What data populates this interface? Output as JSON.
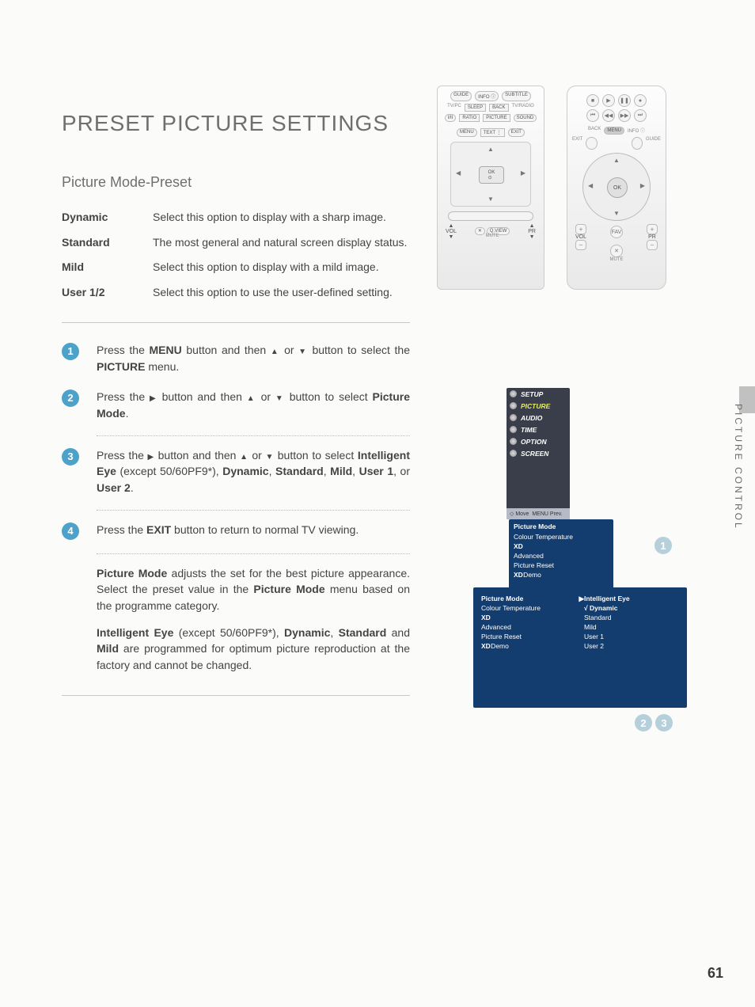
{
  "title": "PRESET PICTURE SETTINGS",
  "subtitle": "Picture Mode-Preset",
  "presets": [
    {
      "term": "Dynamic",
      "desc": "Select this option to display with a sharp image."
    },
    {
      "term": "Standard",
      "desc": "The most general and natural screen display status."
    },
    {
      "term": "Mild",
      "desc": "Select this option to display with a mild image."
    },
    {
      "term": "User 1/2",
      "desc": "Select this option to use the user-defined setting."
    }
  ],
  "steps": [
    "Press the MENU button and then ▲ or ▼ button to select the PICTURE menu.",
    "Press the ▶ button and then ▲ or ▼ button to select Picture Mode.",
    "Press the ▶ button and then ▲ or ▼ button to select Intelligent Eye (except 50/60PF9*), Dynamic, Standard, Mild, User 1, or User 2.",
    "Press the EXIT button to return to normal TV viewing."
  ],
  "note1": "Picture Mode adjusts the set for the best picture appearance. Select the preset value in the Picture Mode menu based on the programme category.",
  "note2": "Intelligent Eye (except 50/60PF9*), Dynamic, Standard and Mild are programmed for optimum picture reproduction at the factory and cannot be changed.",
  "side_tab": "PICTURE CONTROL",
  "page_number": "61",
  "remote_a_buttons": [
    "GUIDE",
    "INFO ⓘ",
    "SUBTITLE",
    "SLEEP",
    "BACK",
    "TV/RADIO",
    "I/II",
    "RATIO",
    "PICTURE",
    "SOUND",
    "MENU",
    "TEXT ⋮",
    "EXIT",
    "OK",
    "VOL",
    "PR",
    "Q.VIEW",
    "MUTE"
  ],
  "remote_b_buttons": [
    "BACK",
    "MENU",
    "INFO ⓘ",
    "EXIT",
    "GUIDE",
    "OK",
    "VOL",
    "PR",
    "FAV",
    "MUTE"
  ],
  "osd1": {
    "left_menu": [
      "SETUP",
      "PICTURE",
      "AUDIO",
      "TIME",
      "OPTION",
      "SCREEN"
    ],
    "left_selected": "PICTURE",
    "footer": [
      "◇ Move",
      "MENU Prev."
    ],
    "right_header": "Picture Mode",
    "right_items": [
      "Colour Temperature",
      "XD",
      "Advanced",
      "Picture Reset",
      "XD Demo"
    ],
    "badge": "1"
  },
  "osd2": {
    "left_items": [
      "Picture Mode",
      "Colour Temperature",
      "XD",
      "Advanced",
      "Picture Reset",
      "XD Demo"
    ],
    "left_selected": "Picture Mode",
    "right_items": [
      "Intelligent Eye",
      "Dynamic",
      "Standard",
      "Mild",
      "User 1",
      "User 2"
    ],
    "right_checked": "Dynamic",
    "badges": [
      "2",
      "3"
    ]
  }
}
